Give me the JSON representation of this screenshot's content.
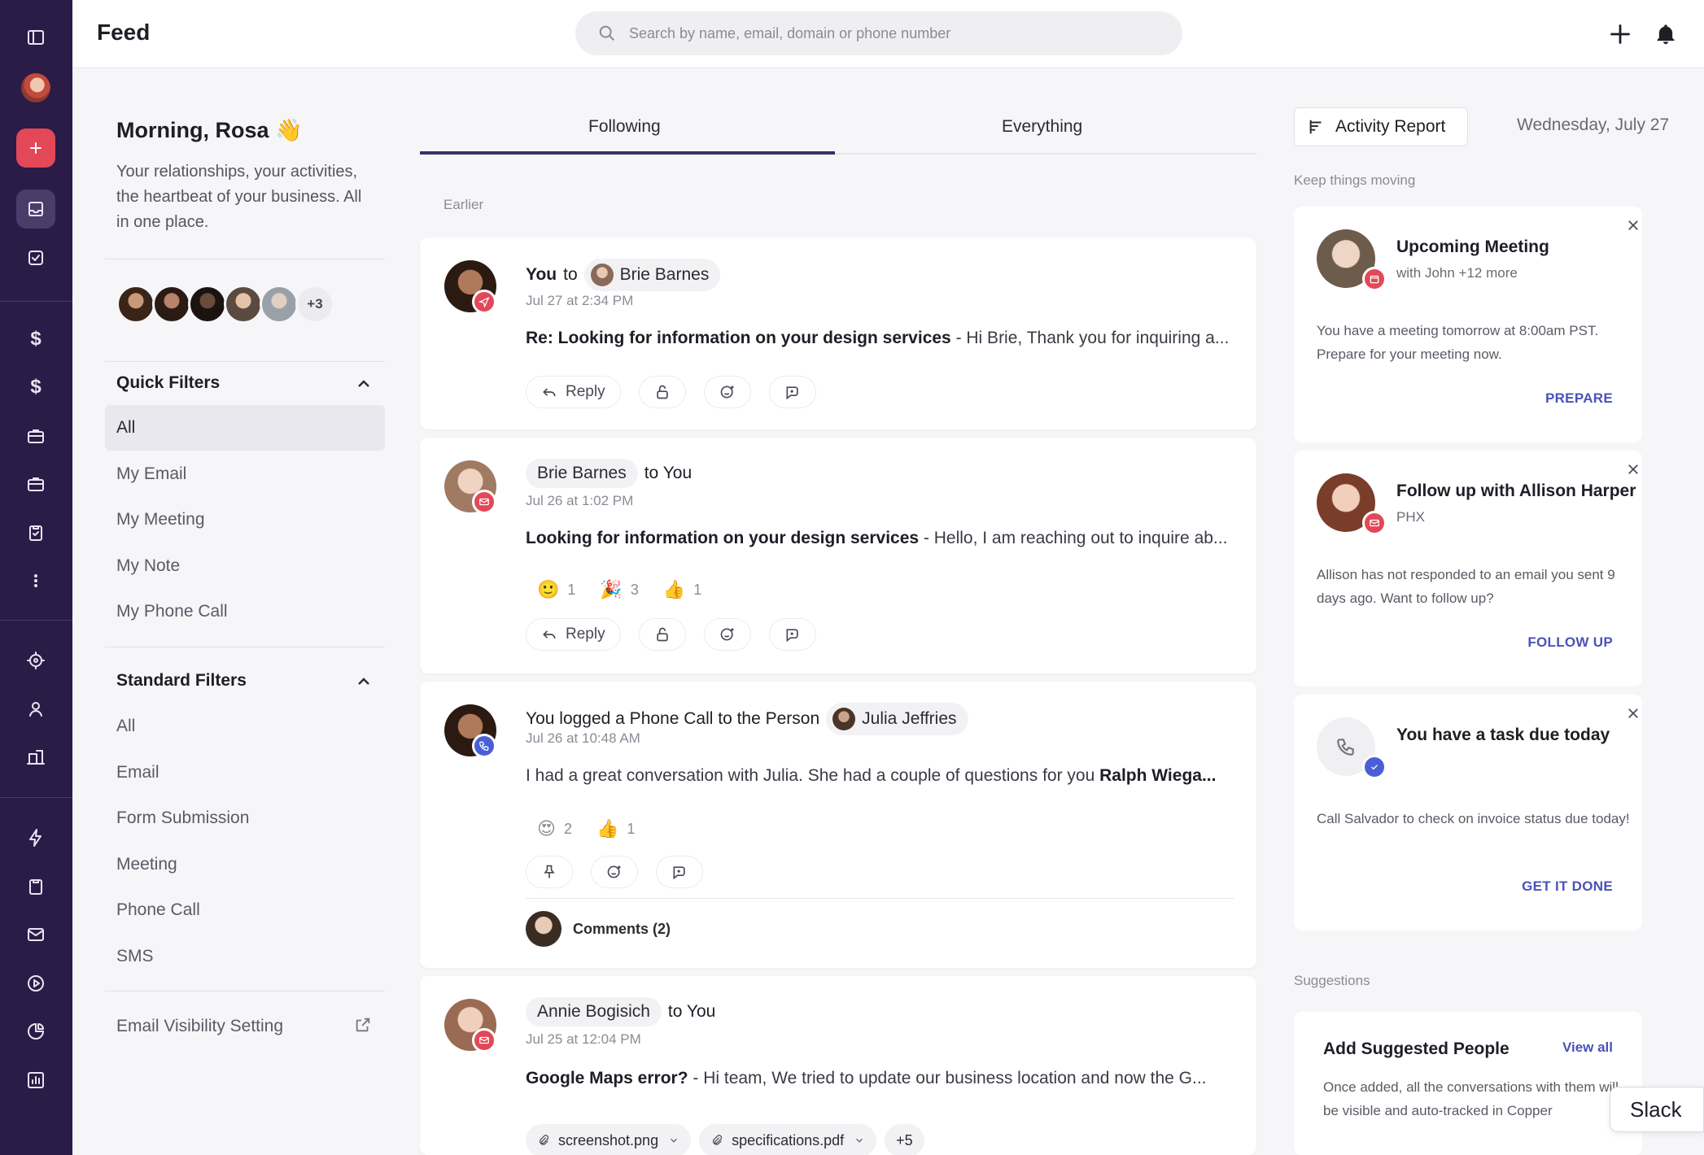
{
  "topbar": {
    "title": "Feed",
    "search_placeholder": "Search by name, email, domain or phone number"
  },
  "left": {
    "greeting": "Morning, Rosa 👋",
    "subtitle": "Your relationships, your activities, the heartbeat of your business. All in one place.",
    "avatars_more": "+3",
    "quick_filters": {
      "title": "Quick Filters",
      "items": [
        "All",
        "My Email",
        "My Meeting",
        "My Note",
        "My Phone Call"
      ]
    },
    "standard_filters": {
      "title": "Standard Filters",
      "items": [
        "All",
        "Email",
        "Form Submission",
        "Meeting",
        "Phone Call",
        "SMS"
      ]
    },
    "email_visibility": "Email Visibility Setting"
  },
  "tabs": [
    "Following",
    "Everything"
  ],
  "feed": {
    "earlier_label": "Earlier",
    "cards": [
      {
        "prefix": "You",
        "connector": "to",
        "person": "Brie Barnes",
        "time": "Jul 27 at 2:34 PM",
        "subject": "Re: Looking for information on your design services",
        "body": " - Hi Brie,  Thank you for inquiring a...",
        "reply": "Reply"
      },
      {
        "person": "Brie Barnes",
        "suffix": "to You",
        "time": "Jul 26 at 1:02 PM",
        "subject": "Looking for information on your design services",
        "body": " - Hello, I am reaching out to inquire ab...",
        "reactions": [
          {
            "emoji": "🙂",
            "count": "1"
          },
          {
            "emoji": "🎉",
            "count": "3"
          },
          {
            "emoji": "👍",
            "count": "1"
          }
        ],
        "reply": "Reply"
      },
      {
        "prefix": "You logged a Phone Call to the Person",
        "person": "Julia Jeffries",
        "time": "Jul 26 at 10:48 AM",
        "body": "I had a great conversation with Julia. She had a couple of questions for you ",
        "mention": "Ralph Wiega...",
        "reactions": [
          {
            "emoji": "😍",
            "count": "2"
          },
          {
            "emoji": "👍",
            "count": "1"
          }
        ],
        "comments": "Comments (2)"
      },
      {
        "person": "Annie Bogisich",
        "suffix": "to You",
        "time": "Jul 25 at 12:04 PM",
        "subject": "Google Maps error?",
        "body": " - Hi team, We tried to update our business location and now the G...",
        "files": [
          "screenshot.png",
          "specifications.pdf"
        ],
        "files_more": "+5"
      }
    ]
  },
  "right": {
    "activity_report": "Activity Report",
    "date": "Wednesday, July 27",
    "keep_moving": "Keep things moving",
    "cards": [
      {
        "title": "Upcoming Meeting",
        "sub": "with John +12 more",
        "body": "You have a meeting tomorrow at 8:00am PST. Prepare for your meeting now.",
        "cta": "PREPARE"
      },
      {
        "title": "Follow up with Allison Harper",
        "sub": "PHX",
        "body": "Allison has not responded to an email you sent 9 days ago. Want to follow up?",
        "cta": "FOLLOW UP"
      },
      {
        "title": "You have a task due today",
        "sub": "",
        "body": "Call Salvador to check on invoice status due today!",
        "cta": "GET IT DONE"
      }
    ],
    "suggestions_label": "Suggestions",
    "suggested": {
      "title": "Add Suggested People",
      "view_all": "View all",
      "body": "Once added, all the conversations with them will be visible and auto-tracked in Copper"
    }
  },
  "slack_label": "Slack",
  "colors": {
    "rail": "#2a1b47",
    "accent_red": "#e24857",
    "accent_blue": "#4a5fd6",
    "link": "#4a52b8",
    "tab_underline": "#3d2c6b"
  }
}
